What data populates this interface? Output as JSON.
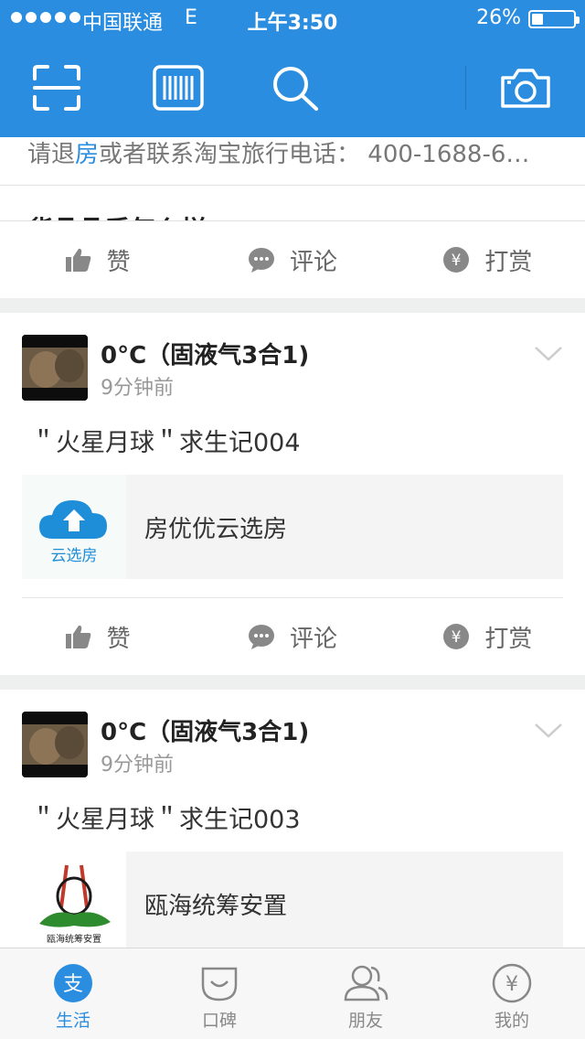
{
  "status": {
    "carrier": "中国联通",
    "network": "E",
    "time": "上午3:50",
    "battery": "26%",
    "battery_level": 0.26
  },
  "nav": {
    "icons": [
      "scan-icon",
      "barcode-icon",
      "search-icon",
      "camera-icon"
    ]
  },
  "partial_card": {
    "text_before": "请退",
    "text_highlight": "房",
    "text_after": "或者联系淘宝旅行电话： 400-1688-6…",
    "title_peek": "货品品质怎么样",
    "actions": {
      "like": "赞",
      "comment": "评论",
      "tip": "打赏"
    }
  },
  "posts": [
    {
      "author": "0°C（固液气3合1)",
      "time": "9分钟前",
      "text": "＂火星月球＂求生记004",
      "link_title": "房优优云选房",
      "thumb_label": "云选房",
      "actions": {
        "like": "赞",
        "comment": "评论",
        "tip": "打赏"
      }
    },
    {
      "author": "0°C（固液气3合1)",
      "time": "9分钟前",
      "text": "＂火星月球＂求生记003",
      "link_title": "瓯海统筹安置",
      "thumb_label": "瓯海统筹安置"
    }
  ],
  "tabs": [
    {
      "label": "生活",
      "icon": "life-icon"
    },
    {
      "label": "口碑",
      "icon": "koubei-icon"
    },
    {
      "label": "朋友",
      "icon": "friends-icon"
    },
    {
      "label": "我的",
      "icon": "wallet-icon"
    }
  ],
  "colors": {
    "brand": "#2b8de0",
    "icon_gray": "#888888"
  }
}
